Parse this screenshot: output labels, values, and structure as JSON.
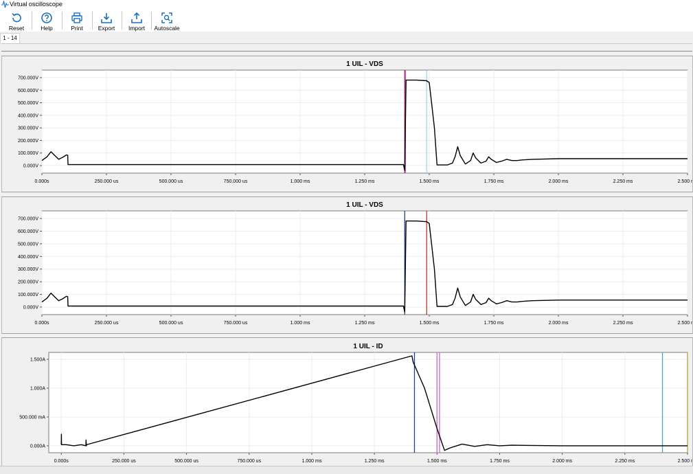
{
  "window": {
    "title": "Virtual oscilloscope"
  },
  "toolbar": {
    "buttons": [
      {
        "label": "Reset",
        "icon": "reset-icon"
      },
      {
        "label": "Help",
        "icon": "help-icon"
      },
      {
        "label": "Print",
        "icon": "print-icon"
      },
      {
        "label": "Export",
        "icon": "export-icon"
      },
      {
        "label": "Import",
        "icon": "import-icon"
      },
      {
        "label": "Autoscale",
        "icon": "autoscale-icon"
      }
    ],
    "accent_color": "#1a6fc4"
  },
  "tabs": [
    {
      "label": "1 - 14"
    }
  ],
  "chart_data": [
    {
      "type": "line",
      "title": "1 UIL -  VDS",
      "xlabel": "",
      "ylabel": "",
      "xlim": [
        0,
        2.5
      ],
      "ylim": [
        -60,
        760
      ],
      "x_ticks": [
        "0.000s",
        "250.000 us",
        "500.000 us",
        "750.000 us",
        "1.000 ms",
        "1.250 ms",
        "1.500 ms",
        "1.750 ms",
        "2.000 ms",
        "2.250 ms",
        "2.500 ms"
      ],
      "x_tick_values": [
        0,
        0.25,
        0.5,
        0.75,
        1.0,
        1.25,
        1.5,
        1.75,
        2.0,
        2.25,
        2.5
      ],
      "y_ticks": [
        "700.000V",
        "600.000V",
        "500.000V",
        "400.000V",
        "300.000V",
        "200.000V",
        "100.000V",
        "0.000V"
      ],
      "y_tick_values": [
        700,
        600,
        500,
        400,
        300,
        200,
        100,
        0
      ],
      "grid": true,
      "series": [
        {
          "color": "#000000",
          "x": [
            0,
            0.02,
            0.035,
            0.05,
            0.065,
            0.08,
            0.095,
            0.1,
            0.101,
            0.5,
            1.0,
            1.4,
            1.405,
            1.41,
            1.45,
            1.49,
            1.5,
            1.52,
            1.53,
            1.57,
            1.59,
            1.6,
            1.61,
            1.62,
            1.64,
            1.66,
            1.67,
            1.68,
            1.7,
            1.72,
            1.73,
            1.74,
            1.76,
            1.78,
            1.8,
            1.82,
            1.84,
            1.86,
            1.9,
            2.0,
            2.2,
            2.5
          ],
          "y": [
            40,
            70,
            110,
            80,
            50,
            65,
            85,
            82,
            8,
            8,
            8,
            8,
            -40,
            680,
            680,
            675,
            660,
            300,
            5,
            5,
            20,
            70,
            150,
            80,
            12,
            40,
            100,
            60,
            20,
            35,
            70,
            50,
            25,
            35,
            50,
            40,
            40,
            45,
            50,
            55,
            55,
            55
          ]
        }
      ],
      "cursors": [
        {
          "x": 1.405,
          "color": "#8b1a4a"
        },
        {
          "x": 1.408,
          "color": "#cc66cc"
        },
        {
          "x": 1.49,
          "color": "#9fd3ef"
        }
      ]
    },
    {
      "type": "line",
      "title": "1 UIL - VDS",
      "xlabel": "",
      "ylabel": "",
      "xlim": [
        0,
        2.5
      ],
      "ylim": [
        -60,
        760
      ],
      "x_ticks": [
        "0.000s",
        "250.000 us",
        "500.000 us",
        "750.000 us",
        "1.000 ms",
        "1.250 ms",
        "1.500 ms",
        "1.750 ms",
        "2.000 ms",
        "2.250 ms",
        "2.500 ms"
      ],
      "x_tick_values": [
        0,
        0.25,
        0.5,
        0.75,
        1.0,
        1.25,
        1.5,
        1.75,
        2.0,
        2.25,
        2.5
      ],
      "y_ticks": [
        "700.000V",
        "600.000V",
        "500.000V",
        "400.000V",
        "300.000V",
        "200.000V",
        "100.000V",
        "0.000V"
      ],
      "y_tick_values": [
        700,
        600,
        500,
        400,
        300,
        200,
        100,
        0
      ],
      "grid": true,
      "series": [
        {
          "color": "#000000",
          "x": [
            0,
            0.02,
            0.035,
            0.05,
            0.065,
            0.08,
            0.095,
            0.1,
            0.101,
            0.5,
            1.0,
            1.4,
            1.405,
            1.41,
            1.45,
            1.49,
            1.5,
            1.52,
            1.53,
            1.57,
            1.59,
            1.6,
            1.61,
            1.62,
            1.64,
            1.66,
            1.67,
            1.68,
            1.7,
            1.72,
            1.73,
            1.74,
            1.76,
            1.78,
            1.8,
            1.82,
            1.84,
            1.86,
            1.9,
            2.0,
            2.2,
            2.5
          ],
          "y": [
            40,
            70,
            110,
            80,
            50,
            65,
            85,
            82,
            8,
            8,
            8,
            8,
            -40,
            680,
            680,
            675,
            660,
            300,
            5,
            5,
            20,
            70,
            150,
            80,
            12,
            40,
            100,
            60,
            20,
            35,
            70,
            50,
            25,
            35,
            50,
            40,
            40,
            45,
            50,
            55,
            55,
            55
          ]
        }
      ],
      "cursors": [
        {
          "x": 1.405,
          "color": "#1f3f8f"
        },
        {
          "x": 1.49,
          "color": "#c0392b"
        }
      ]
    },
    {
      "type": "line",
      "title": "1 UIL -  ID",
      "xlabel": "",
      "ylabel": "",
      "xlim": [
        -0.05,
        2.5
      ],
      "ylim": [
        -0.12,
        1.62
      ],
      "x_ticks": [
        "0.000s",
        "250.000 us",
        "500.000 us",
        "750.000 us",
        "1.000 ms",
        "1.250 ms",
        "1.500 ms",
        "1.750 ms",
        "2.000 ms",
        "2.250 ms",
        "2.500 ms"
      ],
      "x_tick_values": [
        0,
        0.25,
        0.5,
        0.75,
        1.0,
        1.25,
        1.5,
        1.75,
        2.0,
        2.25,
        2.5
      ],
      "y_ticks": [
        "1.500A",
        "1.000A",
        "500.000 mA",
        "0.000A"
      ],
      "y_tick_values": [
        1.5,
        1.0,
        0.5,
        0.0
      ],
      "grid": true,
      "series": [
        {
          "color": "#000000",
          "x": [
            0,
            0.0005,
            0.001,
            0.02,
            0.05,
            0.08,
            0.098,
            0.099,
            0.1,
            0.101,
            1.4,
            1.405,
            1.41,
            1.45,
            1.5,
            1.53,
            1.55,
            1.6,
            1.65,
            1.7,
            1.75,
            1.8,
            2.0,
            2.5
          ],
          "y": [
            0.02,
            0.2,
            0.02,
            0.02,
            0.0,
            0.02,
            0.0,
            0.1,
            0.0,
            0.02,
            1.56,
            1.45,
            1.4,
            1.0,
            0.3,
            -0.08,
            -0.04,
            0.03,
            -0.01,
            0.02,
            0.0,
            0.01,
            0.0,
            0.0
          ]
        }
      ],
      "cursors": [
        {
          "x": 1.41,
          "color": "#1f3f8f"
        },
        {
          "x": 1.5,
          "color": "#cc66cc"
        },
        {
          "x": 1.51,
          "color": "#cc66cc"
        },
        {
          "x": 2.4,
          "color": "#4fa3c8"
        },
        {
          "x": 2.5,
          "color": "#b5a240"
        }
      ]
    }
  ]
}
